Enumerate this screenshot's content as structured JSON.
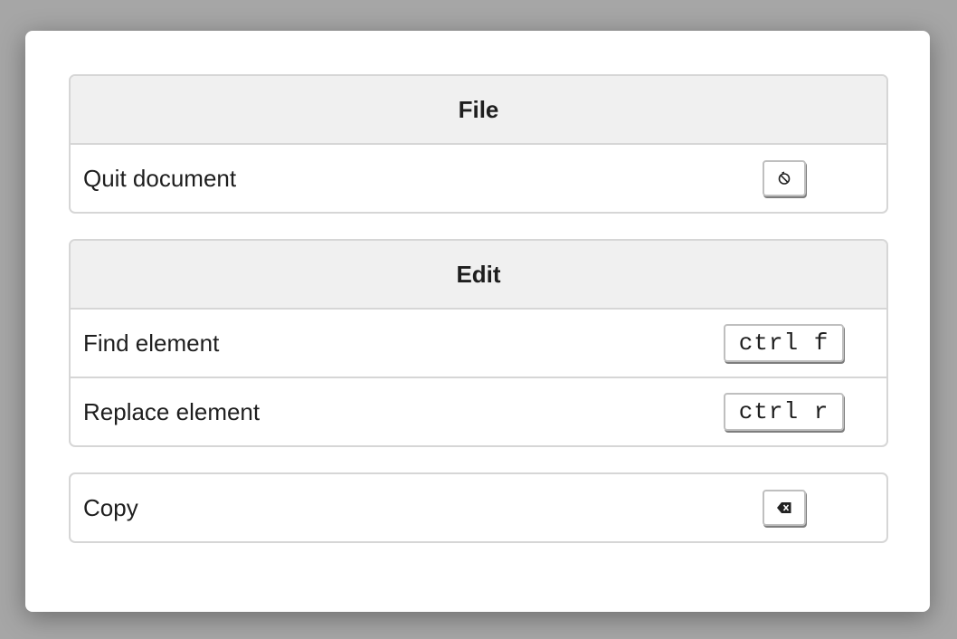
{
  "groups": [
    {
      "title": "File",
      "items": [
        {
          "label": "Quit document",
          "shortcut_icon": "no-entry-icon"
        }
      ]
    },
    {
      "title": "Edit",
      "items": [
        {
          "label": "Find element",
          "shortcut": "ctrl f"
        },
        {
          "label": "Replace element",
          "shortcut": "ctrl r"
        }
      ]
    },
    {
      "title": "",
      "items": [
        {
          "label": "Copy",
          "shortcut_icon": "backspace-icon"
        }
      ]
    }
  ]
}
